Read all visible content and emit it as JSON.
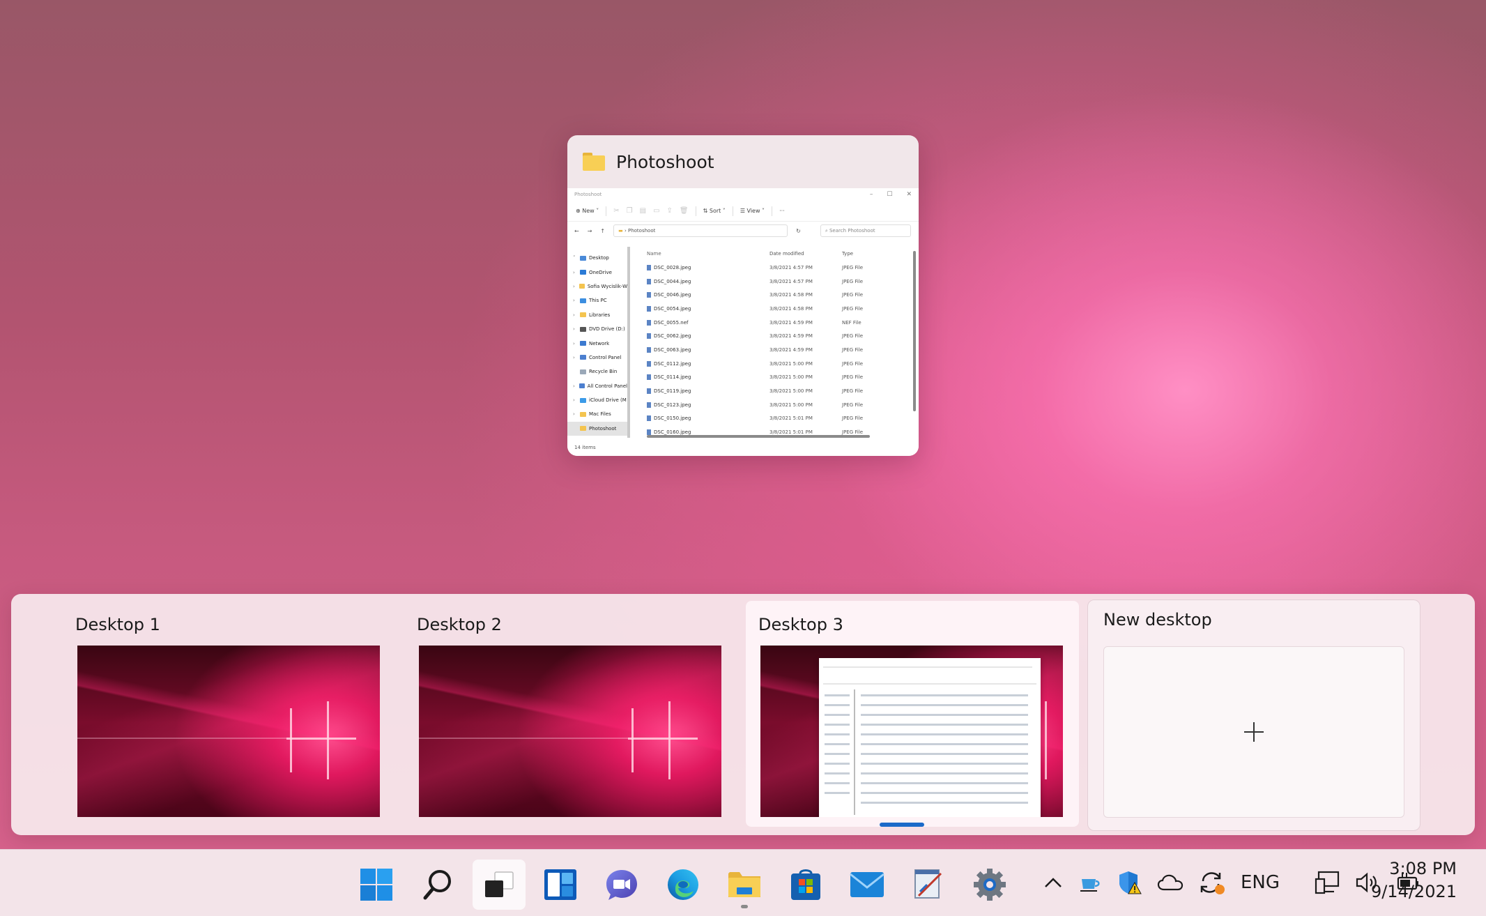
{
  "window_preview": {
    "title": "Photoshoot",
    "explorer": {
      "title_bar": "Photoshoot",
      "toolbar": {
        "new": "New",
        "sort": "Sort",
        "view": "View",
        "more": "···"
      },
      "address": "Photoshoot",
      "search_placeholder": "Search Photoshoot",
      "columns": {
        "name": "Name",
        "date": "Date modified",
        "type": "Type"
      },
      "nav_items": [
        {
          "label": "Desktop",
          "color": "#4a8ad8"
        },
        {
          "label": "OneDrive",
          "color": "#2b7bd6"
        },
        {
          "label": "Sofia Wycislik-W",
          "color": "#f4c44f"
        },
        {
          "label": "This PC",
          "color": "#3c8ee0"
        },
        {
          "label": "Libraries",
          "color": "#f4c44f"
        },
        {
          "label": "DVD Drive (D:)",
          "color": "#555555"
        },
        {
          "label": "Network",
          "color": "#3c7ad0"
        },
        {
          "label": "Control Panel",
          "color": "#4c7fcf"
        },
        {
          "label": "Recycle Bin",
          "color": "#9aa8b8"
        },
        {
          "label": "All Control Panel",
          "color": "#4c7fcf"
        },
        {
          "label": "iCloud Drive (M",
          "color": "#3c9be8"
        },
        {
          "label": "Mac Files",
          "color": "#f4c44f"
        },
        {
          "label": "Photoshoot",
          "color": "#f4c44f"
        }
      ],
      "files": [
        {
          "name": "DSC_0028.jpeg",
          "date": "3/8/2021 4:57 PM",
          "type": "JPEG File"
        },
        {
          "name": "DSC_0044.jpeg",
          "date": "3/8/2021 4:57 PM",
          "type": "JPEG File"
        },
        {
          "name": "DSC_0046.jpeg",
          "date": "3/8/2021 4:58 PM",
          "type": "JPEG File"
        },
        {
          "name": "DSC_0054.jpeg",
          "date": "3/8/2021 4:58 PM",
          "type": "JPEG File"
        },
        {
          "name": "DSC_0055.nef",
          "date": "3/8/2021 4:59 PM",
          "type": "NEF File"
        },
        {
          "name": "DSC_0062.jpeg",
          "date": "3/8/2021 4:59 PM",
          "type": "JPEG File"
        },
        {
          "name": "DSC_0063.jpeg",
          "date": "3/8/2021 4:59 PM",
          "type": "JPEG File"
        },
        {
          "name": "DSC_0112.jpeg",
          "date": "3/8/2021 5:00 PM",
          "type": "JPEG File"
        },
        {
          "name": "DSC_0114.jpeg",
          "date": "3/8/2021 5:00 PM",
          "type": "JPEG File"
        },
        {
          "name": "DSC_0119.jpeg",
          "date": "3/8/2021 5:00 PM",
          "type": "JPEG File"
        },
        {
          "name": "DSC_0123.jpeg",
          "date": "3/8/2021 5:00 PM",
          "type": "JPEG File"
        },
        {
          "name": "DSC_0150.jpeg",
          "date": "3/8/2021 5:01 PM",
          "type": "JPEG File"
        },
        {
          "name": "DSC_0160.jpeg",
          "date": "3/8/2021 5:01 PM",
          "type": "JPEG File"
        }
      ],
      "status": "14 items"
    }
  },
  "desktops": [
    {
      "label": "Desktop 1",
      "active": false
    },
    {
      "label": "Desktop 2",
      "active": false
    },
    {
      "label": "Desktop 3",
      "active": true
    }
  ],
  "new_desktop": {
    "label": "New desktop"
  },
  "taskbar": {
    "icons": [
      "start-icon",
      "search-icon",
      "task-view-icon",
      "widgets-icon",
      "chat-icon",
      "edge-icon",
      "file-explorer-icon",
      "store-icon",
      "mail-icon",
      "snipping-icon",
      "settings-icon"
    ],
    "tray": {
      "language": "ENG",
      "icons": [
        "chevron-up-icon",
        "coffee-icon",
        "defender-warning-icon",
        "onedrive-cloud-icon",
        "sync-icon",
        "network-icon",
        "volume-icon",
        "battery-icon"
      ]
    },
    "clock": {
      "time": "3:08 PM",
      "date": "9/14/2021"
    }
  },
  "colors": {
    "accent": "#1b6ac9",
    "taskbar_bg": "#f3e4e9"
  }
}
